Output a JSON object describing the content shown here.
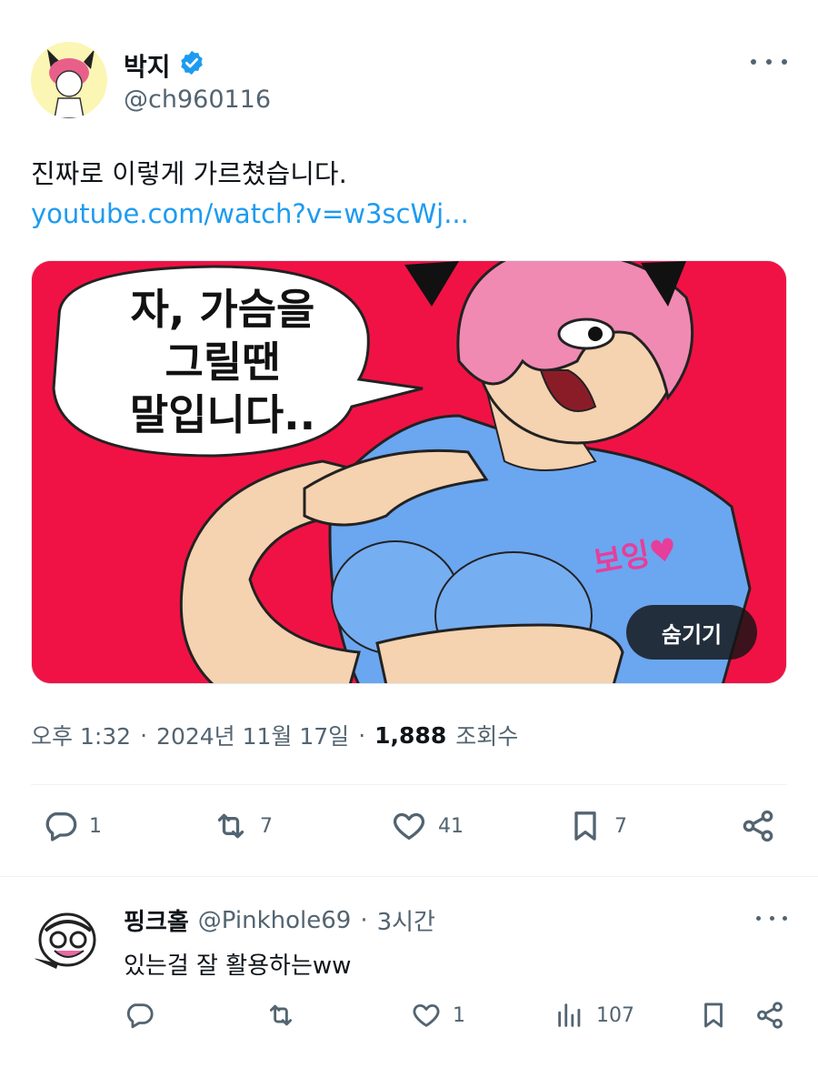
{
  "tweet": {
    "author_name": "박지",
    "handle": "@ch960116",
    "text": "진짜로 이렇게 가르쳤습니다.",
    "link": "youtube.com/watch?v=w3scWj...",
    "media": {
      "speech_bubble": [
        "자, 가슴을",
        "그릴땐",
        "말입니다.."
      ],
      "hide_label": "숨기기"
    },
    "time": "오후 1:32",
    "date": "2024년 11월 17일",
    "views_count": "1,888",
    "views_label": "조회수",
    "separator": "·",
    "counts": {
      "replies": "1",
      "retweets": "7",
      "likes": "41",
      "bookmarks": "7"
    }
  },
  "reply": {
    "name": "핑크홀",
    "handle": "@Pinkhole69",
    "separator": "·",
    "time": "3시간",
    "text": "있는걸 잘 활용하는ww",
    "counts": {
      "replies": "",
      "retweets": "",
      "likes": "1",
      "views": "107"
    }
  },
  "colors": {
    "link": "#1d9bf0",
    "verified": "#1d9bf0",
    "secondary_text": "#536471",
    "media_bg": "#f01245"
  },
  "icons": [
    "verified-badge-icon",
    "more-icon",
    "reply-icon",
    "retweet-icon",
    "like-icon",
    "bookmark-icon",
    "share-icon",
    "views-icon"
  ]
}
